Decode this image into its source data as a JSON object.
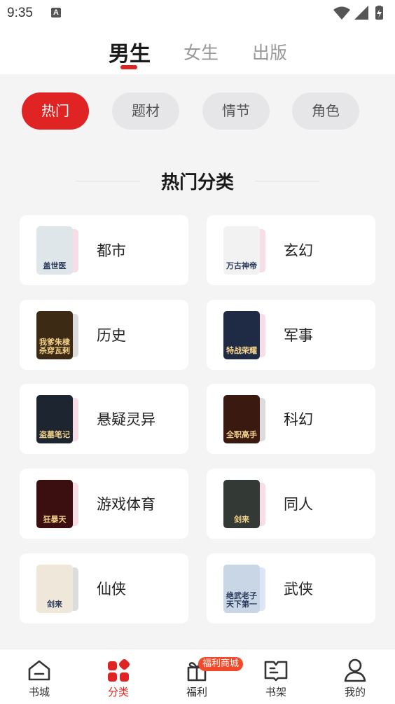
{
  "status_bar": {
    "time": "9:35",
    "notification_letter": "A"
  },
  "top_tabs": [
    {
      "label": "男生",
      "active": true
    },
    {
      "label": "女生",
      "active": false
    },
    {
      "label": "出版",
      "active": false
    }
  ],
  "chips": [
    {
      "label": "热门",
      "active": true
    },
    {
      "label": "题材",
      "active": false
    },
    {
      "label": "情节",
      "active": false
    },
    {
      "label": "角色",
      "active": false
    }
  ],
  "section_title": "热门分类",
  "categories": [
    {
      "label": "都市",
      "cover_text": "盖世医",
      "cover_color": "#dfe6ea"
    },
    {
      "label": "玄幻",
      "cover_text": "万古神帝",
      "cover_color": "#f2f2f2"
    },
    {
      "label": "历史",
      "cover_text": "我爹朱棣 杀穿瓦剌",
      "cover_color": "#3d2a14"
    },
    {
      "label": "军事",
      "cover_text": "特战荣耀",
      "cover_color": "#1f2a44"
    },
    {
      "label": "悬疑灵异",
      "cover_text": "盗墓笔记",
      "cover_color": "#1c2530"
    },
    {
      "label": "科幻",
      "cover_text": "全职高手",
      "cover_color": "#3a1a10"
    },
    {
      "label": "游戏体育",
      "cover_text": "狂暴天",
      "cover_color": "#3b0f10"
    },
    {
      "label": "同人",
      "cover_text": "剑来",
      "cover_color": "#333a35"
    },
    {
      "label": "仙侠",
      "cover_text": "剑来",
      "cover_color": "#efe8da"
    },
    {
      "label": "武侠",
      "cover_text": "绝武老子 天下第一",
      "cover_color": "#c9d6e6"
    }
  ],
  "badge": "福利商城",
  "bottom_nav": [
    {
      "label": "书城",
      "icon": "home-icon",
      "active": false
    },
    {
      "label": "分类",
      "icon": "category-icon",
      "active": true
    },
    {
      "label": "福利",
      "icon": "gift-icon",
      "active": false
    },
    {
      "label": "书架",
      "icon": "bookshelf-icon",
      "active": false
    },
    {
      "label": "我的",
      "icon": "profile-icon",
      "active": false
    }
  ],
  "colors": {
    "accent": "#e02424",
    "chip_bg": "#e6e6e8",
    "page_bg": "#f4f4f5",
    "badge": "#f04a2a"
  }
}
